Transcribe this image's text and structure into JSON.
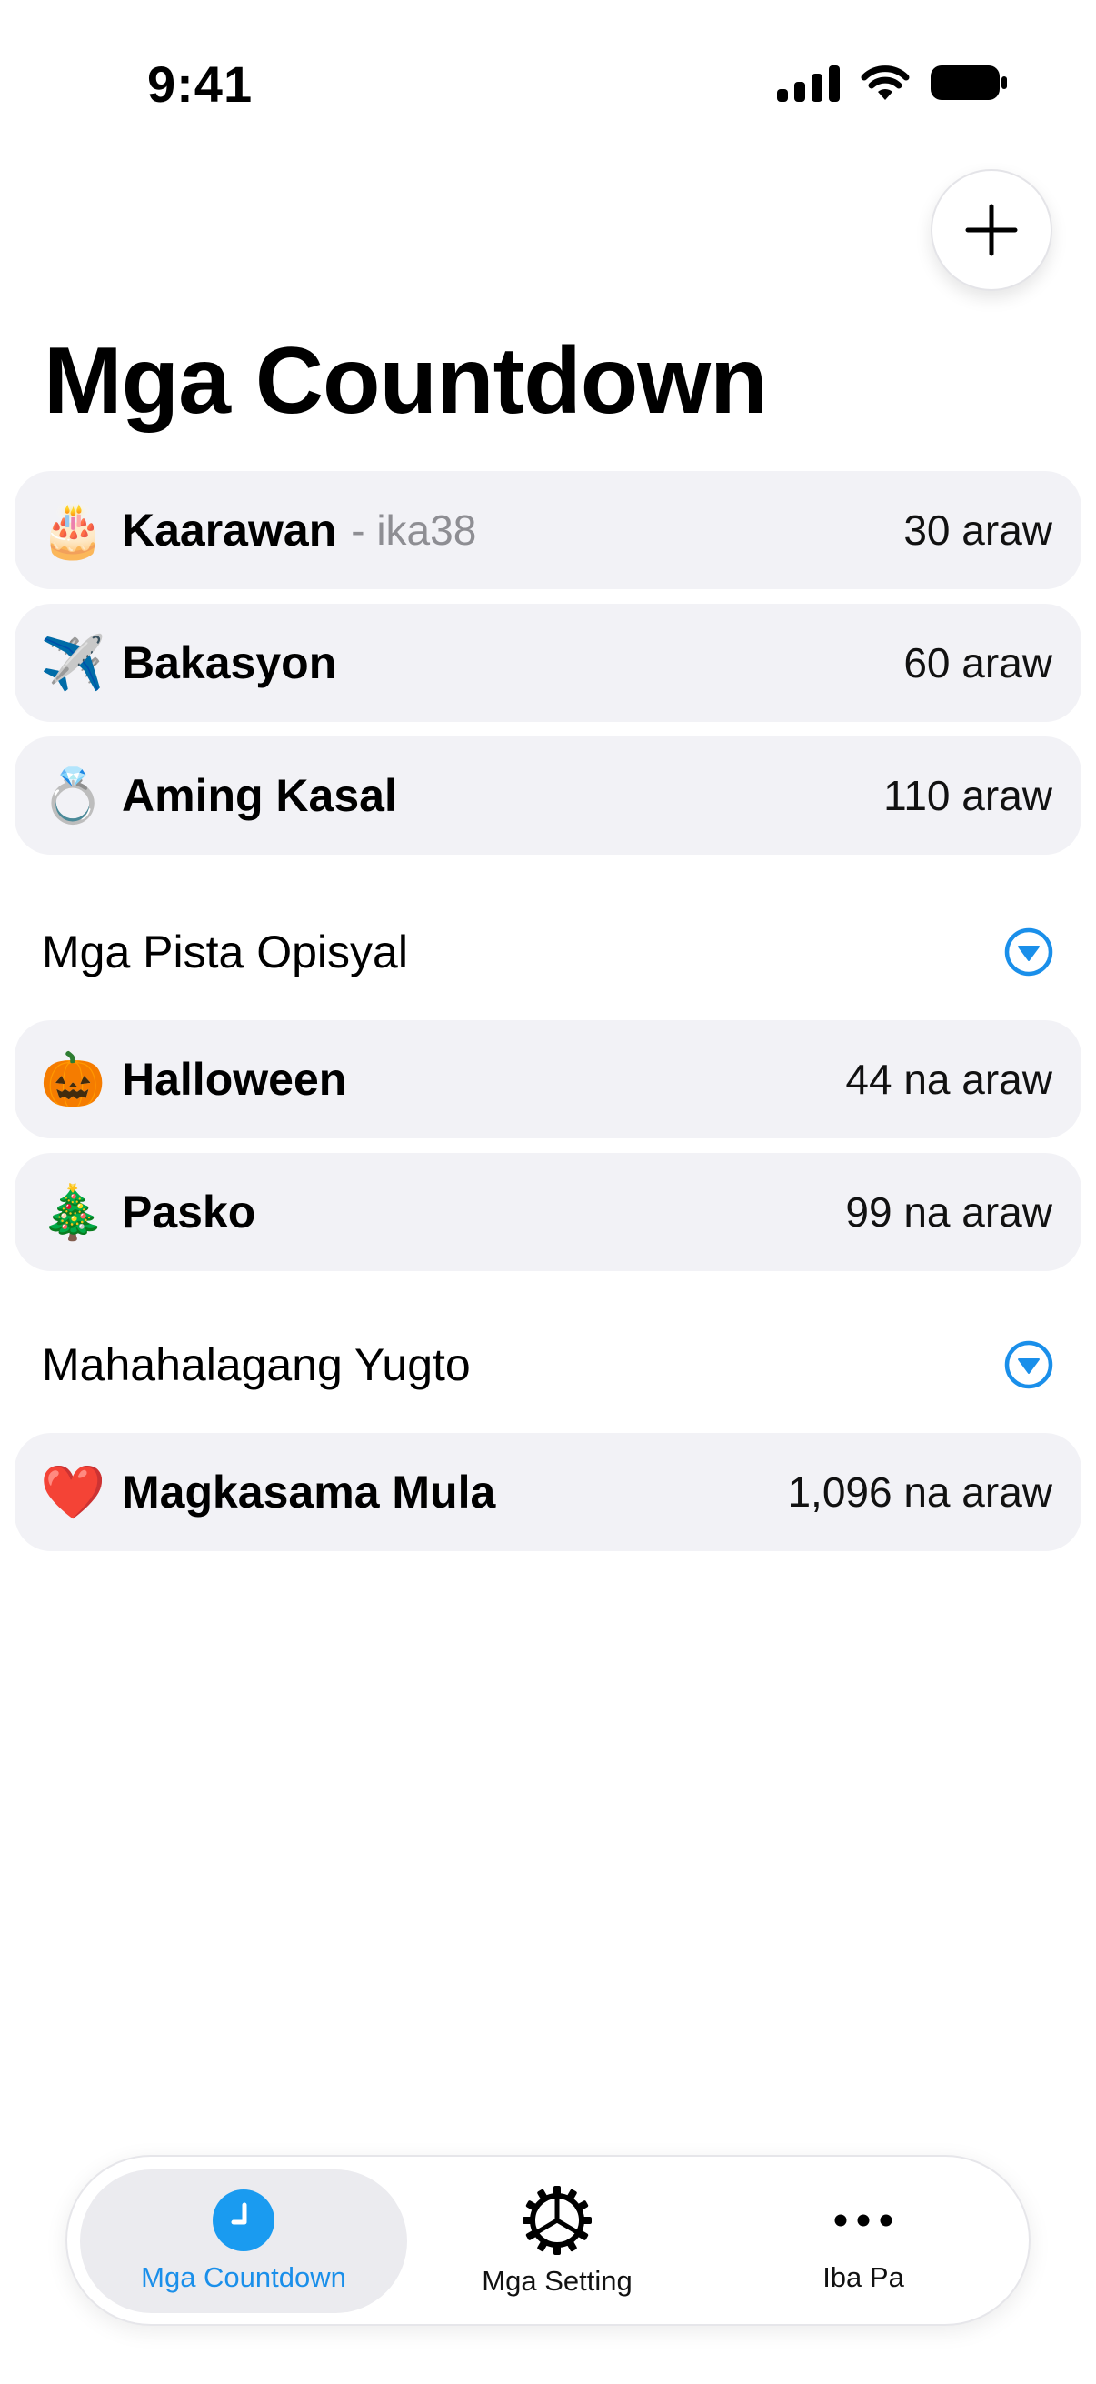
{
  "status_bar": {
    "time": "9:41"
  },
  "header": {
    "title": "Mga Countdown",
    "add_icon": "plus-icon"
  },
  "countdowns": [
    {
      "emoji": "🎂",
      "name": "Kaarawan",
      "sub": "- ika38",
      "days": "30 araw"
    },
    {
      "emoji": "✈️",
      "name": "Bakasyon",
      "sub": "",
      "days": "60 araw"
    },
    {
      "emoji": "💍",
      "name": "Aming Kasal",
      "sub": "",
      "days": "110 araw"
    }
  ],
  "holidays": {
    "title": "Mga Pista Opisyal",
    "items": [
      {
        "emoji": "🎃",
        "name": "Halloween",
        "days": "44 na araw"
      },
      {
        "emoji": "🎄",
        "name": "Pasko",
        "days": "99 na araw"
      }
    ]
  },
  "milestones": {
    "title": "Mahahalagang Yugto",
    "items": [
      {
        "emoji": "❤️",
        "name": "Magkasama Mula",
        "days": "1,096 na araw"
      }
    ]
  },
  "tabbar": {
    "tabs": [
      {
        "label": "Mga Countdown",
        "icon": "clock-icon",
        "active": true
      },
      {
        "label": "Mga Setting",
        "icon": "gear-icon",
        "active": false
      },
      {
        "label": "Iba Pa",
        "icon": "ellipsis-icon",
        "active": false
      }
    ]
  },
  "colors": {
    "accent": "#1a8fea",
    "row_bg": "#f2f2f6"
  }
}
